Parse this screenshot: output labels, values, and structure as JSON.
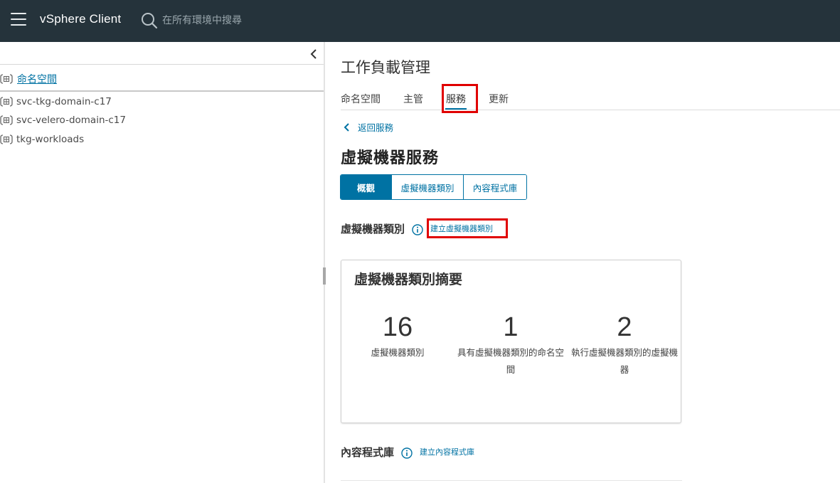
{
  "header": {
    "app_title": "vSphere Client",
    "search_placeholder": "在所有環境中搜尋"
  },
  "sidebar": {
    "root_label": "命名空間",
    "items": [
      {
        "label": "svc-tkg-domain-c17"
      },
      {
        "label": "svc-velero-domain-c17"
      },
      {
        "label": "tkg-workloads"
      }
    ]
  },
  "main": {
    "page_title": "工作負載管理",
    "tabs": [
      {
        "label": "命名空間",
        "active": false
      },
      {
        "label": "主管",
        "active": false
      },
      {
        "label": "服務",
        "active": true
      },
      {
        "label": "更新",
        "active": false
      }
    ],
    "back_link": "返回服務",
    "service_title": "虛擬機器服務",
    "segments": [
      {
        "label": "概觀",
        "active": true
      },
      {
        "label": "虛擬機器類別",
        "active": false
      },
      {
        "label": "內容程式庫",
        "active": false
      }
    ],
    "vm_class_section": {
      "title": "虛擬機器類別",
      "action_link": "建立虛擬機器類別"
    },
    "summary_card": {
      "title": "虛擬機器類別摘要",
      "stats": [
        {
          "value": "16",
          "caption": "虛擬機器類別"
        },
        {
          "value": "1",
          "caption": "具有虛擬機器類別的命名空間"
        },
        {
          "value": "2",
          "caption": "執行虛擬機器類別的虛擬機器"
        }
      ]
    },
    "content_library_section": {
      "title": "內容程式庫",
      "action_link": "建立內容程式庫"
    }
  },
  "colors": {
    "header_bg": "#25333b",
    "accent": "#0072a3",
    "highlight_box": "#e00000"
  }
}
